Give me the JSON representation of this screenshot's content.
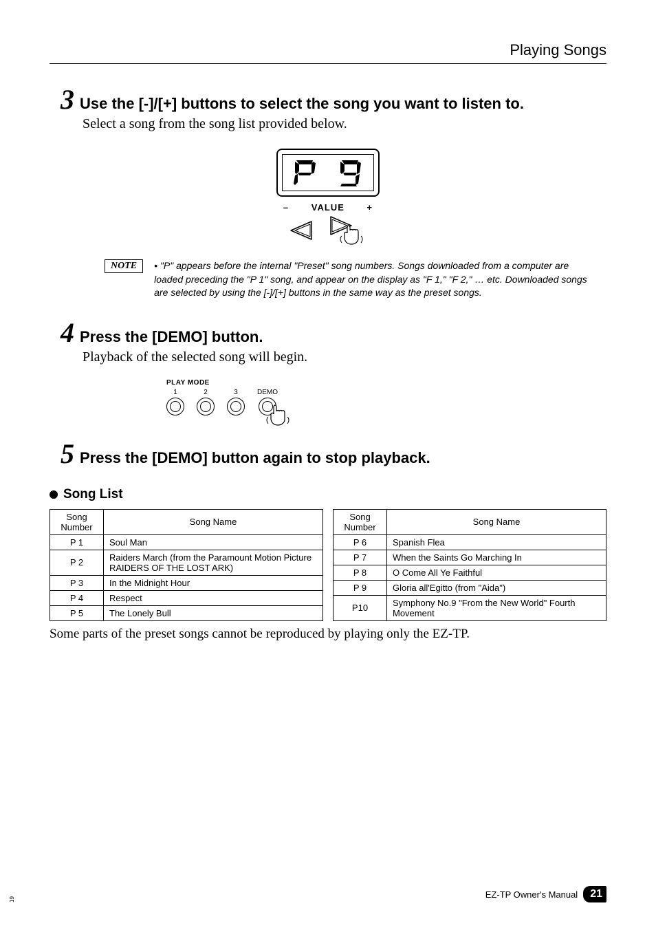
{
  "header": "Playing Songs",
  "steps": {
    "s3": {
      "num": "3",
      "title": "Use the [-]/[+] buttons to select the song you want to listen to.",
      "body": "Select a song from the song list provided below."
    },
    "s4": {
      "num": "4",
      "title": "Press the [DEMO] button.",
      "body": "Playback of the selected song will begin."
    },
    "s5": {
      "num": "5",
      "title": "Press the [DEMO] button again to stop playback."
    }
  },
  "display": {
    "char_left": "P",
    "char_right": "9",
    "value_label": "VALUE",
    "minus": "–",
    "plus": "+"
  },
  "note": {
    "label": "NOTE",
    "text": "\"P\" appears before the internal \"Preset\" song numbers. Songs downloaded from a computer are loaded preceding the \"P 1\" song, and appear on the display as \"F 1,\" \"F 2,\" … etc. Downloaded songs are selected by using the [-]/[+] buttons in the same way as the preset songs."
  },
  "playmode": {
    "label": "PLAY MODE",
    "b1": "1",
    "b2": "2",
    "b3": "3",
    "demo": "DEMO"
  },
  "songlist": {
    "title": "Song List",
    "th_num": "Song Number",
    "th_name": "Song Name",
    "left": {
      "r1": {
        "num": "P 1",
        "name": "Soul Man"
      },
      "r2": {
        "num": "P 2",
        "name": "Raiders March (from the Paramount Motion Picture RAIDERS OF THE LOST ARK)"
      },
      "r3": {
        "num": "P 3",
        "name": "In the Midnight Hour"
      },
      "r4": {
        "num": "P 4",
        "name": "Respect"
      },
      "r5": {
        "num": "P 5",
        "name": "The Lonely Bull"
      }
    },
    "right": {
      "r1": {
        "num": "P 6",
        "name": "Spanish Flea"
      },
      "r2": {
        "num": "P 7",
        "name": "When the Saints Go Marching In"
      },
      "r3": {
        "num": "P 8",
        "name": "O Come All Ye Faithful"
      },
      "r4": {
        "num": "P 9",
        "name": "Gloria all'Egitto (from \"Aida\")"
      },
      "r5": {
        "num": "P10",
        "name": "Symphony No.9 \"From the New World\" Fourth Movement"
      }
    },
    "note": "Some parts of the preset songs cannot be reproduced by playing only the EZ-TP."
  },
  "footer": {
    "text": "EZ-TP  Owner's Manual",
    "page": "21",
    "side": "19"
  }
}
